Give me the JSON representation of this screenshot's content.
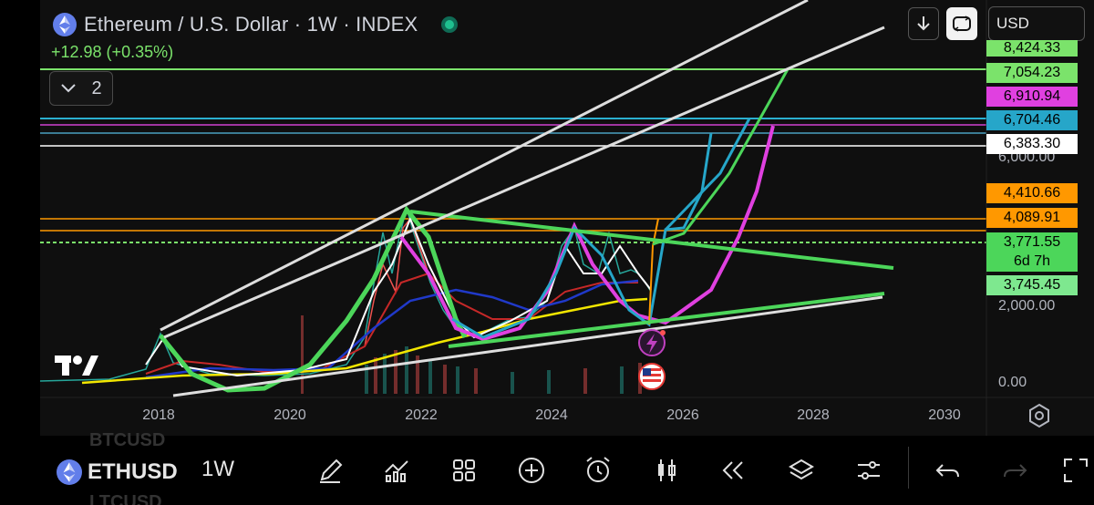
{
  "header": {
    "title": "Ethereum / U.S. Dollar · 1W · INDEX",
    "price_change": "+12.98 (+0.35%)",
    "indicators_count": "2",
    "currency": "USD"
  },
  "price_tags": [
    {
      "label": "8,424.33",
      "bg": "#7be36b",
      "color": "#000000"
    },
    {
      "label": "7,054.23",
      "bg": "#7be36b",
      "color": "#000000"
    },
    {
      "label": "6,910.94",
      "bg": "#e040e0",
      "color": "#000000"
    },
    {
      "label": "6,704.46",
      "bg": "#26a6c9",
      "color": "#000000"
    },
    {
      "label": "6,383.30",
      "bg": "#ffffff",
      "color": "#000000"
    },
    {
      "label": "4,410.66",
      "bg": "#ff9800",
      "color": "#000000"
    },
    {
      "label": "4,089.91",
      "bg": "#ff9800",
      "color": "#000000"
    },
    {
      "label": "3,771.55",
      "bg": "#4cd65a",
      "color": "#000000"
    },
    {
      "label": "6d 7h",
      "bg": "#4cd65a",
      "color": "#000000"
    },
    {
      "label": "3,745.45",
      "bg": "#7ee88f",
      "color": "#000000"
    }
  ],
  "axis": {
    "partial_label": "6,000.00",
    "label_2000": "2,000.00",
    "label_0": "0.00"
  },
  "years": [
    "2018",
    "2020",
    "2022",
    "2024",
    "2026",
    "2028",
    "2030"
  ],
  "ghost": {
    "top": "BTCUSD",
    "bottom": "LTCUSD"
  },
  "bottom_bar": {
    "symbol": "ETHUSD",
    "interval": "1W"
  },
  "colors": {
    "green": "#4cd65a",
    "magenta": "#e040e0",
    "cyan": "#26a6c9",
    "white": "#e8e8e8",
    "orange": "#ff9800",
    "yellow": "#f2e600"
  }
}
